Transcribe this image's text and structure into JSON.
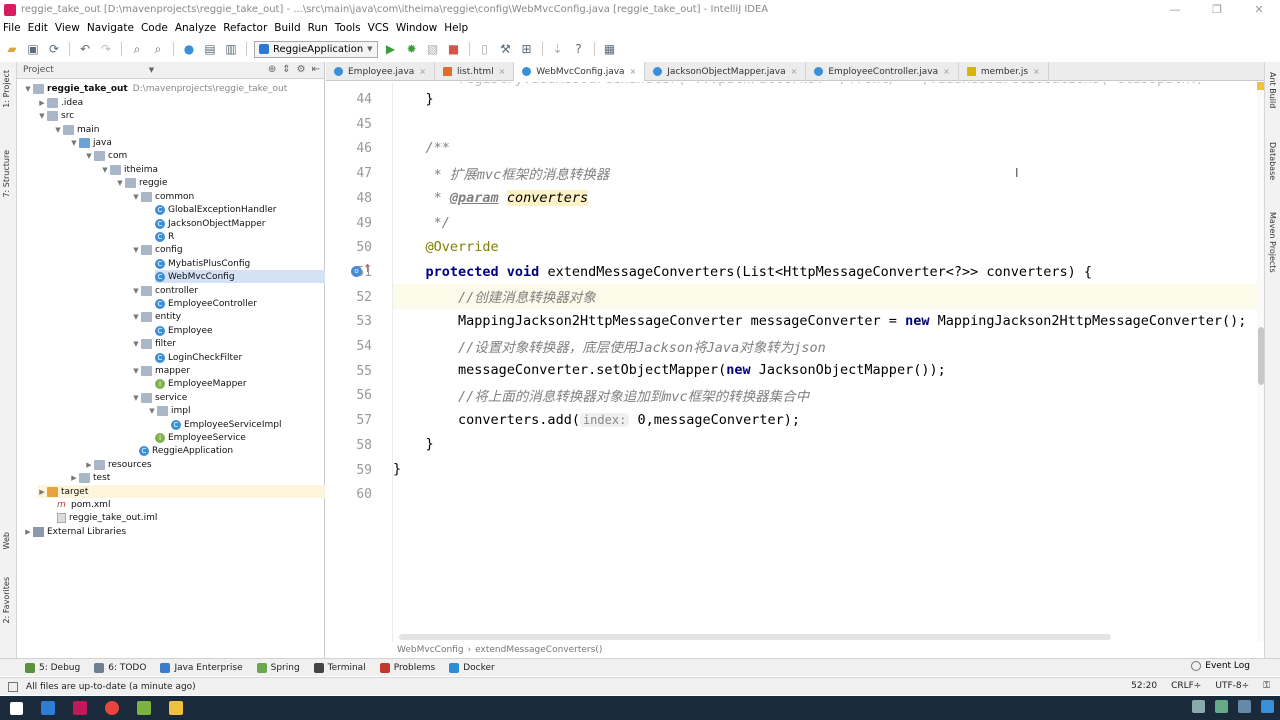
{
  "window": {
    "title": "reggie_take_out [D:\\mavenprojects\\reggie_take_out] - ...\\src\\main\\java\\com\\itheima\\reggie\\config\\WebMvcConfig.java [reggie_take_out] - IntelliJ IDEA",
    "minimize": "—",
    "maximize": "❐",
    "close": "✕"
  },
  "menu": [
    "File",
    "Edit",
    "View",
    "Navigate",
    "Code",
    "Analyze",
    "Refactor",
    "Build",
    "Run",
    "Tools",
    "VCS",
    "Window",
    "Help"
  ],
  "toolbar": {
    "run_config": "ReggieApplication",
    "run_config_arrow": "▼"
  },
  "left_strip": {
    "project": "1: Project",
    "structure": "7: Structure",
    "web": "Web",
    "favorites": "2: Favorites"
  },
  "project_panel": {
    "header": "Project",
    "header_arrow": "▼",
    "rows": [
      {
        "label": "reggie_take_out",
        "path": "D:\\mavenprojects\\reggie_take_out",
        "arrow": "▼"
      },
      {
        "label": ".idea",
        "arrow": "▶"
      },
      {
        "label": "src",
        "arrow": "▼"
      },
      {
        "label": "main",
        "arrow": "▼"
      },
      {
        "label": "java",
        "arrow": "▼"
      },
      {
        "label": "com",
        "arrow": "▼"
      },
      {
        "label": "itheima",
        "arrow": "▼"
      },
      {
        "label": "reggie",
        "arrow": "▼"
      },
      {
        "label": "common",
        "arrow": "▼"
      },
      {
        "label": "GlobalExceptionHandler",
        "icon_letter": "C"
      },
      {
        "label": "JacksonObjectMapper",
        "icon_letter": "C"
      },
      {
        "label": "R",
        "icon_letter": "C"
      },
      {
        "label": "config",
        "arrow": "▼"
      },
      {
        "label": "MybatisPlusConfig",
        "icon_letter": "C"
      },
      {
        "label": "WebMvcConfig",
        "icon_letter": "C"
      },
      {
        "label": "controller",
        "arrow": "▼"
      },
      {
        "label": "EmployeeController",
        "icon_letter": "C"
      },
      {
        "label": "entity",
        "arrow": "▼"
      },
      {
        "label": "Employee",
        "icon_letter": "C"
      },
      {
        "label": "filter",
        "arrow": "▼"
      },
      {
        "label": "LoginCheckFilter",
        "icon_letter": "C"
      },
      {
        "label": "mapper",
        "arrow": "▼"
      },
      {
        "label": "EmployeeMapper",
        "icon_letter": "I"
      },
      {
        "label": "service",
        "arrow": "▼"
      },
      {
        "label": "impl",
        "arrow": "▼"
      },
      {
        "label": "EmployeeServiceImpl",
        "icon_letter": "C"
      },
      {
        "label": "EmployeeService",
        "icon_letter": "I"
      },
      {
        "label": "ReggieApplication",
        "icon_letter": "C"
      },
      {
        "label": "resources",
        "arrow": "▶"
      },
      {
        "label": "test",
        "arrow": "▶"
      },
      {
        "label": "target",
        "arrow": "▶"
      },
      {
        "label": "pom.xml",
        "icon_letter": "m"
      },
      {
        "label": "reggie_take_out.iml"
      },
      {
        "label": "External Libraries",
        "arrow": "▶"
      }
    ]
  },
  "editor_tabs": [
    {
      "label": "Employee.java",
      "close": "×"
    },
    {
      "label": "list.html",
      "close": "×"
    },
    {
      "label": "WebMvcConfig.java",
      "close": "×"
    },
    {
      "label": "JacksonObjectMapper.java",
      "close": "×"
    },
    {
      "label": "EmployeeController.java",
      "close": "×"
    },
    {
      "label": "member.js",
      "close": "×"
    }
  ],
  "editor": {
    "line_numbers": [
      "44",
      "45",
      "46",
      "47",
      "48",
      "49",
      "50",
      "51",
      "52",
      "53",
      "54",
      "55",
      "56",
      "57",
      "58",
      "59",
      "60"
    ],
    "top_partial": "        registry.addResourceHandler( ...pathPatterns: \"/front/**\").addResourceLocations(\"classpath:/",
    "lines": {
      "l44": "    }",
      "l46": "    /**",
      "l47": "     * 扩展mvc框架的消息转换器",
      "l48_tag": "@param",
      "l48_name": "converters",
      "l49": "     */",
      "l50": "@Override",
      "l51_kw": "protected void",
      "l51_rest": " extendMessageConverters(List<HttpMessageConverter<?>> converters) {",
      "l52": "//创建消息转换器对象",
      "l53_a": "MappingJackson2HttpMessageConverter messageConverter = ",
      "l53_kw": "new",
      "l53_b": " MappingJackson2HttpMessageConverter();",
      "l54": "//设置对象转换器，底层使用Jackson将Java对象转为json",
      "l55_a": "messageConverter.setObjectMapper(",
      "l55_kw": "new",
      "l55_b": " JacksonObjectMapper());",
      "l56": "//将上面的消息转换器对象追加到mvc框架的转换器集合中",
      "l57_a": "converters.add(",
      "l57_hint": "index:",
      "l57_b": " 0,messageConverter);",
      "l58": "    }",
      "l59": "}"
    }
  },
  "breadcrumb": {
    "class": "WebMvcConfig",
    "sep": "›",
    "method": "extendMessageConverters()"
  },
  "right_strip": {
    "ant": "Ant Build",
    "db": "Database",
    "maven": "Maven Projects"
  },
  "bottom_tabs": [
    {
      "label": "5: Debug",
      "color": "#5a8f3c"
    },
    {
      "label": "6: TODO",
      "color": "#6d7f93"
    },
    {
      "label": "Java Enterprise",
      "color": "#3a7bc8"
    },
    {
      "label": "Spring",
      "color": "#6aa84f"
    },
    {
      "label": "Terminal",
      "color": "#444444"
    },
    {
      "label": "Problems",
      "color": "#c0392b"
    },
    {
      "label": "Docker",
      "color": "#2a8fd6"
    }
  ],
  "event_log": "Event Log",
  "status": {
    "message": "All files are up-to-date (a minute ago)",
    "position": "52:20",
    "line_sep": "CRLF÷",
    "encoding": "UTF-8÷"
  },
  "colors": {
    "keyword": "#000080",
    "comment": "#808080",
    "annotation": "#808000",
    "taskbar": "#1b2a3a"
  }
}
